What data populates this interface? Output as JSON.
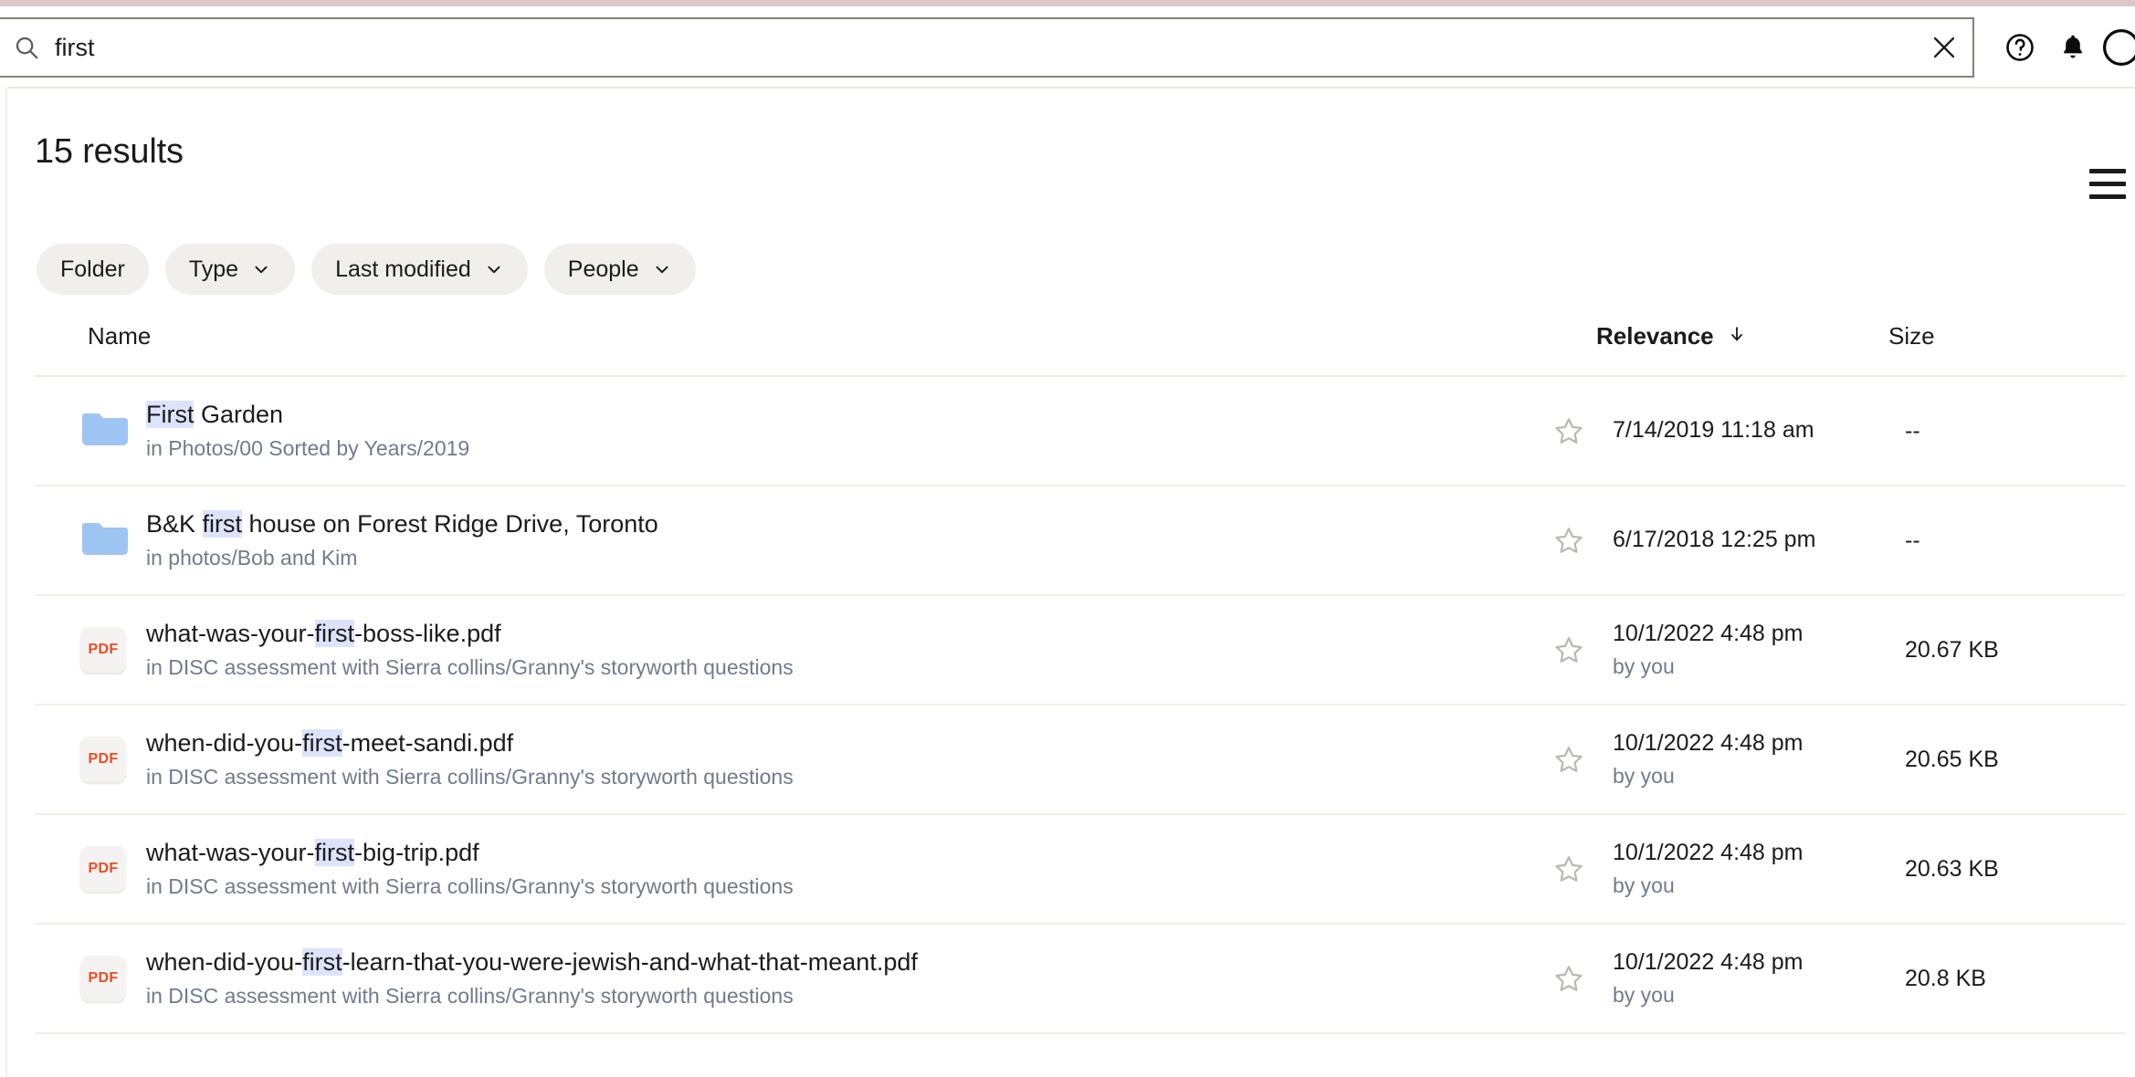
{
  "topbar": {
    "search": {
      "icon": "search-icon",
      "value": "first",
      "placeholder": "Search",
      "clear_icon": "close-icon"
    },
    "actions": [
      {
        "name": "help-icon",
        "label": "Help"
      },
      {
        "name": "bell-icon",
        "label": "Notifications"
      },
      {
        "name": "avatar",
        "label": "Account"
      }
    ]
  },
  "results": {
    "heading": "15 results",
    "view_toggle_icon": "list-view-icon"
  },
  "filters": [
    {
      "label": "Folder",
      "has_chevron": false
    },
    {
      "label": "Type",
      "has_chevron": true
    },
    {
      "label": "Last modified",
      "has_chevron": true
    },
    {
      "label": "People",
      "has_chevron": true
    }
  ],
  "table": {
    "columns": [
      {
        "label": "Name",
        "sorted": false
      },
      {
        "label": "Relevance",
        "sorted": true,
        "sort_icon": "arrow-down-icon"
      },
      {
        "label": "Size",
        "sorted": false
      }
    ],
    "rows": [
      {
        "icon": "folder-icon",
        "icon_type": "folder",
        "name_pre": "",
        "name_hl": "First",
        "name_post": " Garden",
        "path": "in Photos/00 Sorted by Years/2019",
        "star_icon": "star-outline-icon",
        "date": "7/14/2019 11:18 am",
        "by": "",
        "size": "--"
      },
      {
        "icon": "folder-icon",
        "icon_type": "folder",
        "name_pre": "B&K ",
        "name_hl": "first",
        "name_post": " house on Forest Ridge Drive, Toronto",
        "path": "in photos/Bob and Kim",
        "star_icon": "star-outline-icon",
        "date": "6/17/2018 12:25 pm",
        "by": "",
        "size": "--"
      },
      {
        "icon": "pdf-icon",
        "icon_type": "pdf",
        "icon_label": "PDF",
        "name_pre": "what-was-your-",
        "name_hl": "first",
        "name_post": "-boss-like.pdf",
        "path": "in DISC assessment with Sierra collins/Granny's storyworth questions",
        "star_icon": "star-outline-icon",
        "date": "10/1/2022 4:48 pm",
        "by": "by you",
        "size": "20.67 KB"
      },
      {
        "icon": "pdf-icon",
        "icon_type": "pdf",
        "icon_label": "PDF",
        "name_pre": "when-did-you-",
        "name_hl": "first",
        "name_post": "-meet-sandi.pdf",
        "path": "in DISC assessment with Sierra collins/Granny's storyworth questions",
        "star_icon": "star-outline-icon",
        "date": "10/1/2022 4:48 pm",
        "by": "by you",
        "size": "20.65 KB"
      },
      {
        "icon": "pdf-icon",
        "icon_type": "pdf",
        "icon_label": "PDF",
        "name_pre": "what-was-your-",
        "name_hl": "first",
        "name_post": "-big-trip.pdf",
        "path": "in DISC assessment with Sierra collins/Granny's storyworth questions",
        "star_icon": "star-outline-icon",
        "date": "10/1/2022 4:48 pm",
        "by": "by you",
        "size": "20.63 KB"
      },
      {
        "icon": "pdf-icon",
        "icon_type": "pdf",
        "icon_label": "PDF",
        "name_pre": "when-did-you-",
        "name_hl": "first",
        "name_post": "-learn-that-you-were-jewish-and-what-that-meant.pdf",
        "path": "in DISC assessment with Sierra collins/Granny's storyworth questions",
        "star_icon": "star-outline-icon",
        "date": "10/1/2022 4:48 pm",
        "by": "by you",
        "size": "20.8 KB"
      }
    ]
  },
  "colors": {
    "accent_strip": "#dfc9c4",
    "highlight": "#dde3fb",
    "folder_blue": "#9ec5f2",
    "pdf_orange": "#ef4b23",
    "pill_bg": "#f0efeb",
    "divider": "#f2ede6",
    "muted_text": "#707b8c"
  }
}
